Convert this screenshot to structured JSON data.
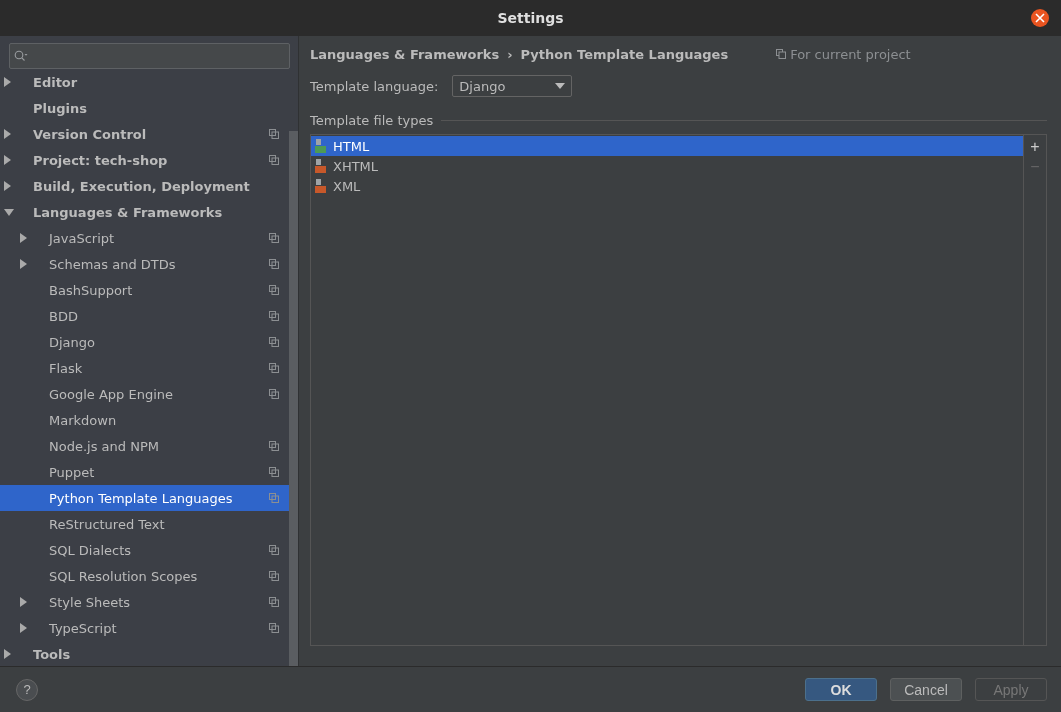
{
  "window": {
    "title": "Settings"
  },
  "sidebar": {
    "items": [
      {
        "label": "Editor",
        "expanded": false,
        "project": false,
        "selected": false
      },
      {
        "label": "Plugins",
        "project": false,
        "selected": false
      },
      {
        "label": "Version Control",
        "expanded": false,
        "project": true,
        "selected": false
      },
      {
        "label": "Project: tech-shop",
        "expanded": false,
        "project": true,
        "selected": false
      },
      {
        "label": "Build, Execution, Deployment",
        "expanded": false,
        "project": false,
        "selected": false
      },
      {
        "label": "Languages & Frameworks",
        "expanded": true,
        "project": false,
        "selected": false,
        "children": [
          {
            "label": "JavaScript",
            "expanded": false,
            "project": true,
            "selected": false
          },
          {
            "label": "Schemas and DTDs",
            "expanded": false,
            "project": true,
            "selected": false
          },
          {
            "label": "BashSupport",
            "project": true,
            "selected": false
          },
          {
            "label": "BDD",
            "project": true,
            "selected": false
          },
          {
            "label": "Django",
            "project": true,
            "selected": false
          },
          {
            "label": "Flask",
            "project": true,
            "selected": false
          },
          {
            "label": "Google App Engine",
            "project": true,
            "selected": false
          },
          {
            "label": "Markdown",
            "project": false,
            "selected": false
          },
          {
            "label": "Node.js and NPM",
            "project": true,
            "selected": false
          },
          {
            "label": "Puppet",
            "project": true,
            "selected": false
          },
          {
            "label": "Python Template Languages",
            "project": true,
            "selected": true
          },
          {
            "label": "ReStructured Text",
            "project": false,
            "selected": false
          },
          {
            "label": "SQL Dialects",
            "project": true,
            "selected": false
          },
          {
            "label": "SQL Resolution Scopes",
            "project": true,
            "selected": false
          },
          {
            "label": "Style Sheets",
            "expanded": false,
            "project": true,
            "selected": false
          },
          {
            "label": "TypeScript",
            "expanded": false,
            "project": true,
            "selected": false
          }
        ]
      },
      {
        "label": "Tools",
        "expanded": false,
        "project": false,
        "selected": false
      }
    ]
  },
  "breadcrumb": {
    "parent": "Languages & Frameworks",
    "separator": "›",
    "current": "Python Template Languages",
    "scope": "For current project"
  },
  "template_language": {
    "label": "Template language:",
    "value": "Django"
  },
  "file_types": {
    "title": "Template file types",
    "items": [
      {
        "label": "HTML",
        "kind": "html",
        "selected": true
      },
      {
        "label": "XHTML",
        "kind": "xhtml",
        "selected": false
      },
      {
        "label": "XML",
        "kind": "xml",
        "selected": false
      }
    ],
    "add": "+",
    "remove": "−"
  },
  "footer": {
    "help": "?",
    "buttons": [
      {
        "label": "OK",
        "kind": "default",
        "disabled": false
      },
      {
        "label": "Cancel",
        "kind": "normal",
        "disabled": false
      },
      {
        "label": "Apply",
        "kind": "normal",
        "disabled": true
      }
    ]
  }
}
